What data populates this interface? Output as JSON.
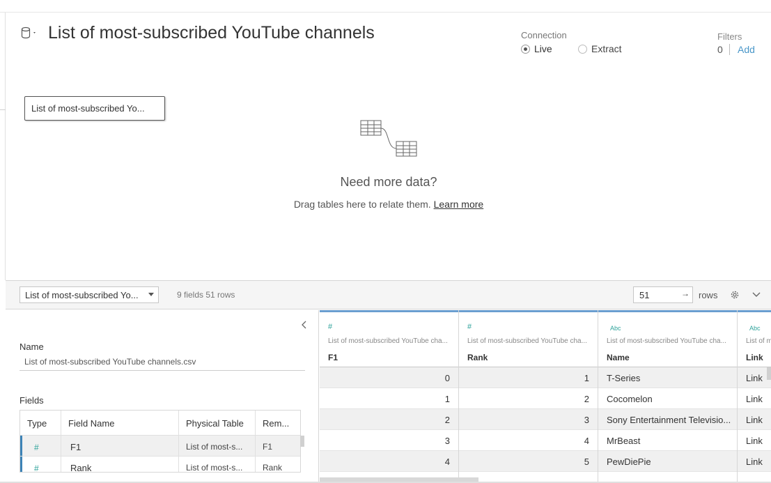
{
  "datasource": {
    "title": "List of most-subscribed YouTube channels",
    "icon": "database-icon"
  },
  "connection": {
    "label": "Connection",
    "options": [
      "Live",
      "Extract"
    ],
    "selected": "Live"
  },
  "filters": {
    "label": "Filters",
    "count": "0",
    "add_label": "Add"
  },
  "canvas": {
    "table_name": "List of most-subscribed Yo...",
    "need_more": "Need more data?",
    "drag_text": "Drag tables here to relate them.",
    "learn_more": "Learn more"
  },
  "toolbar": {
    "table_select": "List of most-subscribed Yo...",
    "fields_rows": "9 fields 51 rows",
    "rows_value": "51",
    "rows_label": "rows"
  },
  "metadata": {
    "name_label": "Name",
    "name_value": "List of most-subscribed YouTube channels.csv",
    "fields_label": "Fields",
    "columns": [
      "Type",
      "Field Name",
      "Physical Table",
      "Rem..."
    ],
    "rows": [
      {
        "type": "#",
        "field": "F1",
        "table": "List of most-s...",
        "remote": "F1"
      },
      {
        "type": "#",
        "field": "Rank",
        "table": "List of most-s...",
        "remote": "Rank"
      }
    ]
  },
  "grid": {
    "columns": [
      {
        "type": "#",
        "source": "List of most-subscribed YouTube cha...",
        "name": "F1",
        "align": "num"
      },
      {
        "type": "#",
        "source": "List of most-subscribed YouTube cha...",
        "name": "Rank",
        "align": "num"
      },
      {
        "type": "Abc",
        "source": "List of most-subscribed YouTube cha...",
        "name": "Name",
        "align": "txt"
      },
      {
        "type": "Abc",
        "source": "List of m",
        "name": "Link",
        "align": "txt"
      }
    ],
    "rows": [
      [
        "0",
        "1",
        "T-Series",
        "Link"
      ],
      [
        "1",
        "2",
        "Cocomelon",
        "Link"
      ],
      [
        "2",
        "3",
        "Sony Entertainment Televisio...",
        "Link"
      ],
      [
        "3",
        "4",
        "MrBeast",
        "Link"
      ],
      [
        "4",
        "5",
        "PewDiePie",
        "Link"
      ]
    ]
  }
}
